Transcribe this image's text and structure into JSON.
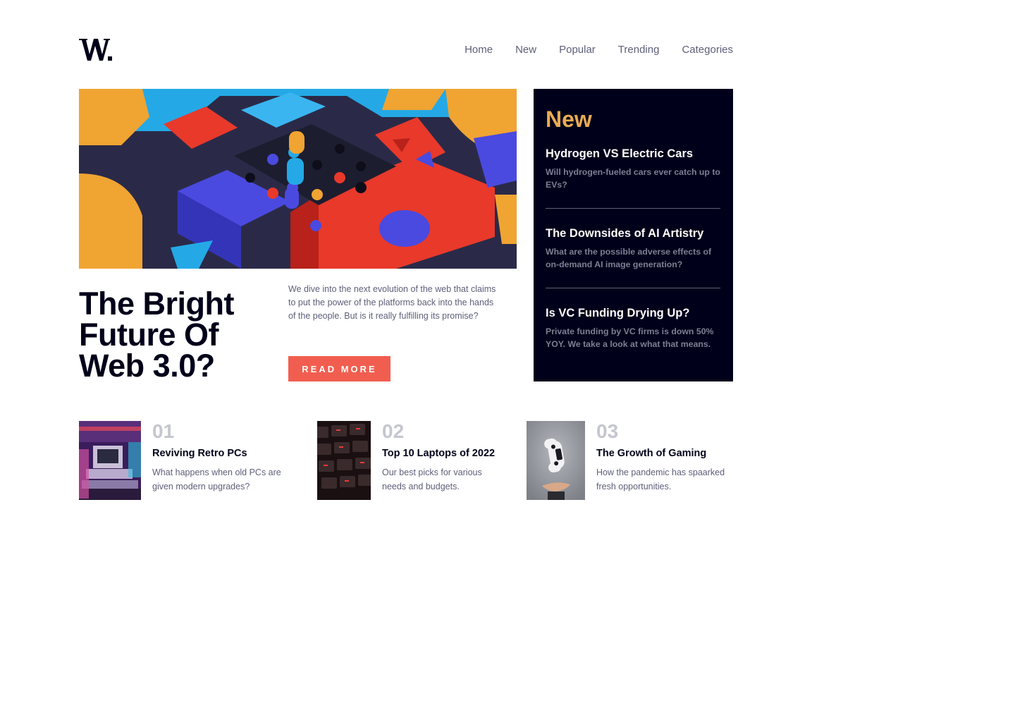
{
  "brand": {
    "logo_text": "W."
  },
  "nav": {
    "items": [
      "Home",
      "New",
      "Popular",
      "Trending",
      "Categories"
    ]
  },
  "hero": {
    "title": "The Bright Future Of Web 3.0?",
    "description": "We dive into the next evolution of the web that claims to put the power of the platforms back into the hands of the people. But is it really fulfilling its promise?",
    "button_label": "READ MORE"
  },
  "new_panel": {
    "heading": "New",
    "items": [
      {
        "title": "Hydrogen VS Electric Cars",
        "summary": "Will hydrogen-fueled cars ever catch up to EVs?"
      },
      {
        "title": "The Downsides of AI Artistry",
        "summary": "What are the possible adverse effects of on-demand AI image generation?"
      },
      {
        "title": "Is VC Funding Drying Up?",
        "summary": "Private funding by VC firms is down 50% YOY. We take a look at what that means."
      }
    ]
  },
  "cards": [
    {
      "number": "01",
      "title": "Reviving Retro PCs",
      "summary": "What happens when old PCs are given modern upgrades?"
    },
    {
      "number": "02",
      "title": "Top 10 Laptops of 2022",
      "summary": "Our best picks for various needs and budgets."
    },
    {
      "number": "03",
      "title": "The Growth of Gaming",
      "summary": "How the pandemic has spaarked fresh opportunities."
    }
  ],
  "colors": {
    "accent_orange": "#e9ab53",
    "accent_red": "#f15e50",
    "dark_navy": "#00001a",
    "grayish_blue": "#5d5f79",
    "off_white": "#fffdfa"
  }
}
